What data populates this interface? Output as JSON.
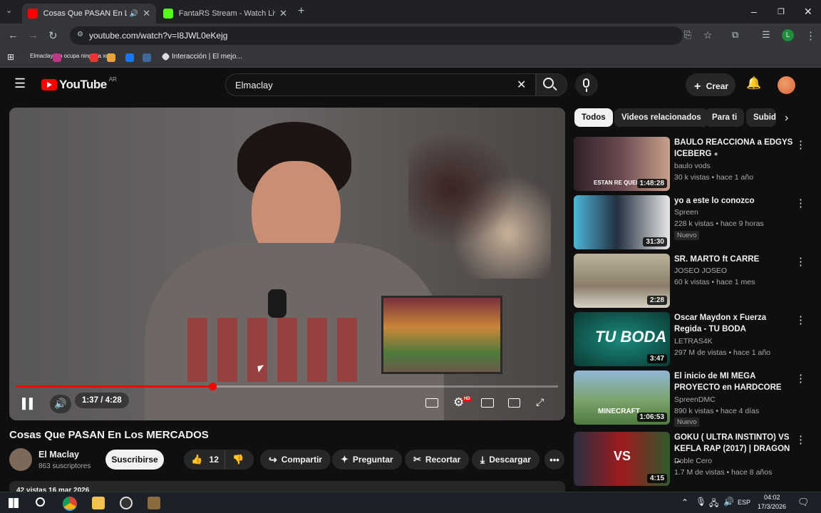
{
  "browser": {
    "tabs": [
      {
        "title": "Cosas Que PASAN En Los M",
        "favicon_color": "#ff0000"
      },
      {
        "title": "FantaRS Stream - Watch Live on",
        "favicon_color": "#53fc18"
      }
    ],
    "url": "youtube.com/watch?v=I8JWL0eKejg",
    "bookmarks": [
      {
        "label": "Elmaclay ido ocupa ninguna xd"
      },
      {
        "label": "Interacción | El mejo..."
      }
    ]
  },
  "masthead": {
    "logo": "YouTube",
    "region": "AR",
    "search_value": "Elmaclay",
    "create_label": "Crear"
  },
  "player": {
    "time_display": "1:37 / 4:28",
    "progress_fraction": 0.362,
    "hd_badge": "HD"
  },
  "video": {
    "title": "Cosas Que PASAN En Los MERCADOS",
    "channel_name": "El Maclay",
    "subscribers": "863 suscriptores",
    "subscribe_label": "Suscribirse",
    "likes": "12",
    "share_label": "Compartir",
    "ask_label": "Preguntar",
    "clip_label": "Recortar",
    "download_label": "Descargar",
    "stats": "42 vistas  16 mar 2026"
  },
  "chips": [
    "Todos",
    "Videos relacionados",
    "Para ti",
    "Subid"
  ],
  "recommendations": [
    {
      "title": "BAULO REACCIONA a EDGYS ICEBERG",
      "channel": "baulo vods",
      "meta": "30 k vistas • hace 1 año",
      "duration": "1:48:28",
      "thumb_caption": "ESTAN RE QUEMA",
      "badge": "",
      "thumb_color": "#3a2430"
    },
    {
      "title": "yo a este lo conozco",
      "channel": "Spreen",
      "meta": "228 k vistas • hace 9 horas",
      "duration": "31:30",
      "thumb_caption": "",
      "badge": "Nuevo",
      "thumb_color": "#cfd6dc"
    },
    {
      "title": "SR. MARTO ft CARRE",
      "channel": "JOSEO JOSEO",
      "meta": "60 k vistas • hace 1 mes",
      "duration": "2:28",
      "thumb_caption": "",
      "badge": "",
      "thumb_color": "#9d927c"
    },
    {
      "title": "Oscar Maydon x Fuerza Regida - TU BODA",
      "channel": "LETRAS4K",
      "meta": "297 M de vistas • hace 1 año",
      "duration": "3:47",
      "thumb_caption": "TU BODA",
      "badge": "",
      "thumb_color": "#0d5a52"
    },
    {
      "title": "El inicio de MI MEGA PROYECTO en HARDCORE",
      "channel": "SpreenDMC",
      "meta": "890 k vistas • hace 4 días",
      "duration": "1:06:53",
      "thumb_caption": "MINECRAFT",
      "badge": "Nuevo",
      "thumb_color": "#6f9c5a"
    },
    {
      "title": "GOKU ( ULTRA INSTINTO) VS KEFLA RAP (2017) | DRAGON ...",
      "channel": "Doble Cero",
      "meta": "1.7 M de vistas • hace 8 años",
      "duration": "4:15",
      "thumb_caption": "VS",
      "badge": "",
      "thumb_color": "#7a1d20"
    }
  ],
  "taskbar": {
    "lang": "ESP",
    "time": "04:02",
    "date": "17/3/2026"
  }
}
